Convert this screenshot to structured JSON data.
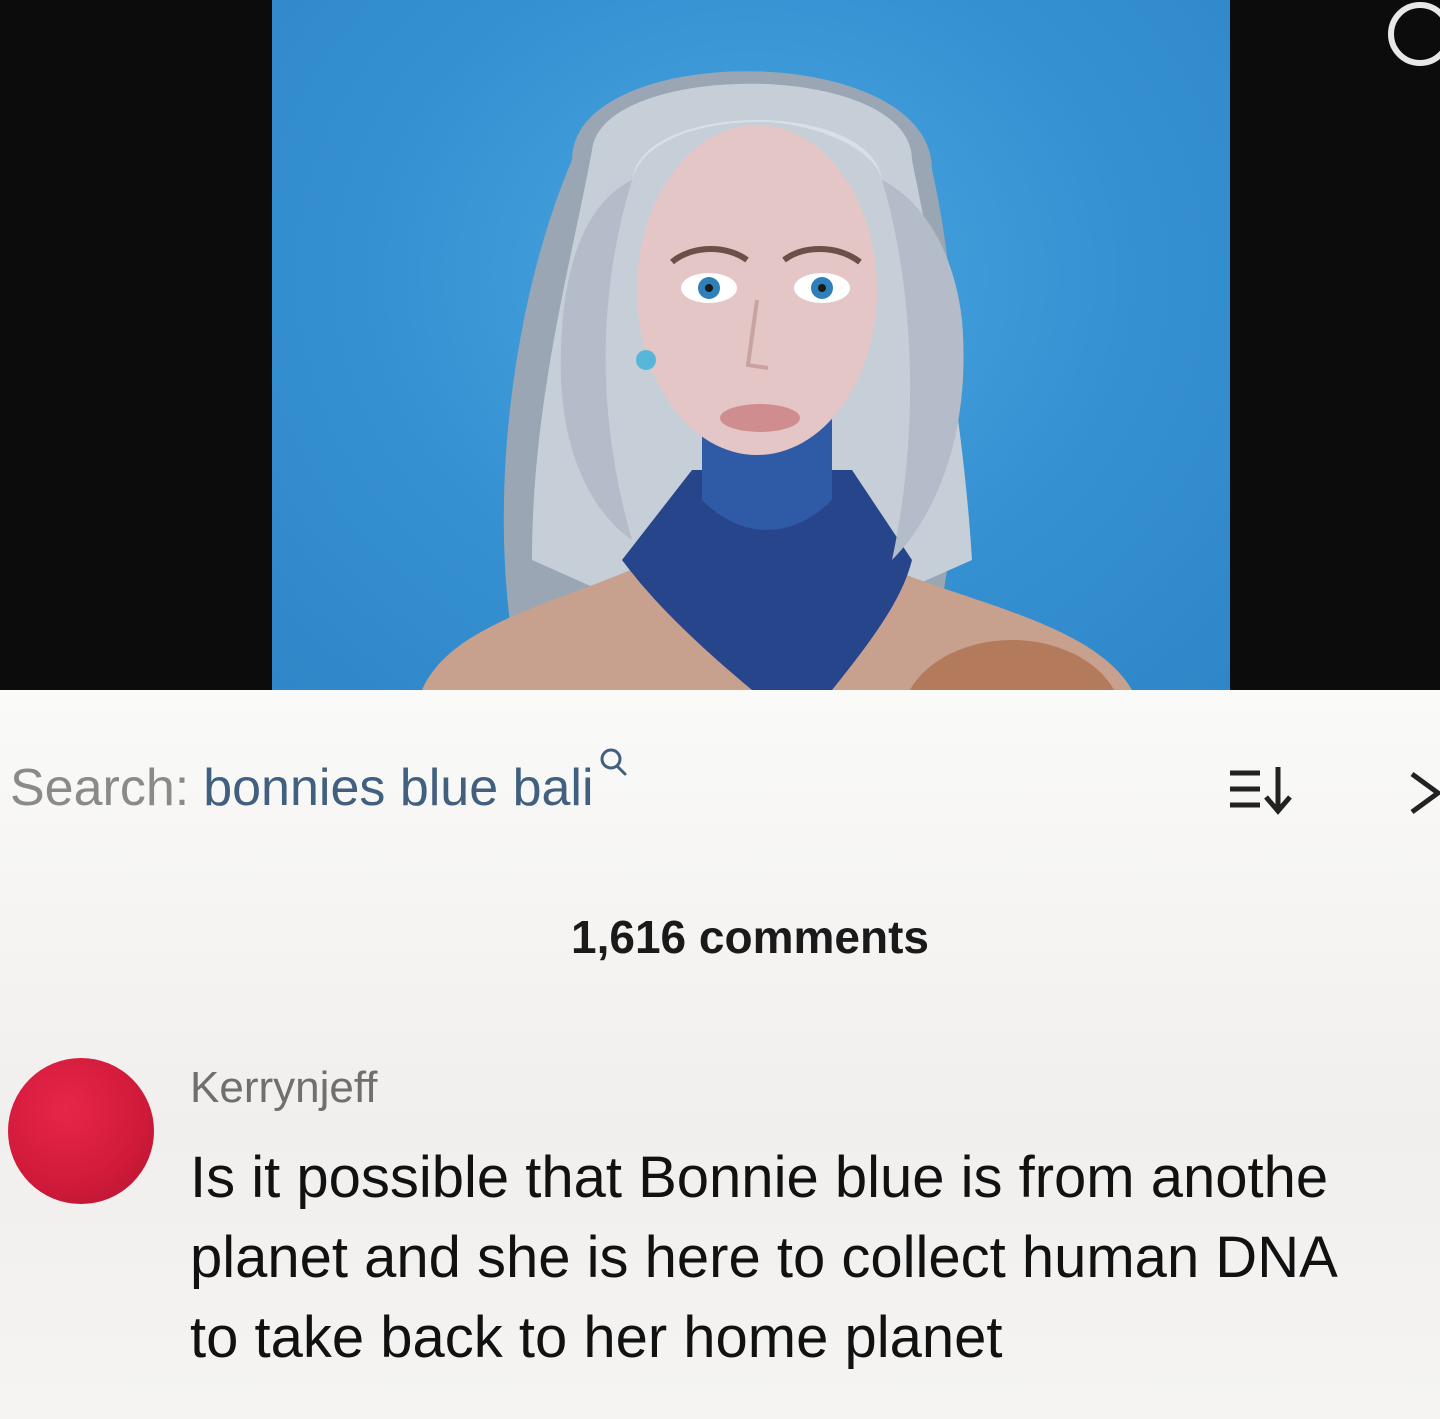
{
  "search": {
    "prefix": "Search:",
    "term": "bonnies blue bali"
  },
  "comments_header": {
    "count_label": "1,616 comments"
  },
  "comment": {
    "username": "Kerrynjeff",
    "lines": [
      "Is it possible that Bonnie blue is from anothe",
      "planet and she is here to collect human DNA",
      "to take back to her home planet"
    ]
  },
  "icons": {
    "search_mini": "search-icon",
    "sort": "sort-icon",
    "close": "close-icon",
    "top_right": "circle-icon"
  },
  "colors": {
    "search_term": "#415f7f",
    "avatar": "#d01a3a",
    "video_background": "#3591d2"
  }
}
